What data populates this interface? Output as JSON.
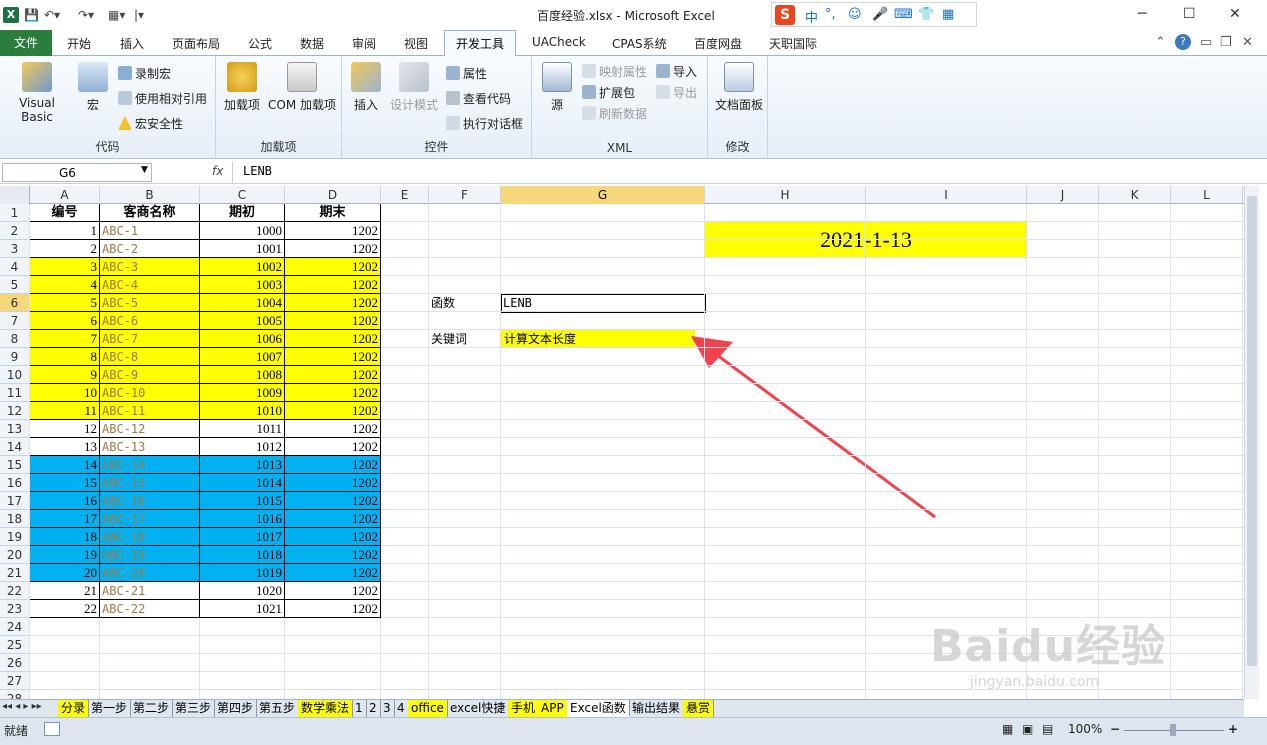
{
  "window": {
    "title": "百度经验.xlsx - Microsoft Excel",
    "logo": "X",
    "minimize": "─",
    "maximize": "☐",
    "close": "✕"
  },
  "ime": {
    "logo": "S",
    "items": [
      "中",
      "°,",
      "☺",
      "🎤",
      "⌨",
      "👕",
      "▦"
    ]
  },
  "tabs": {
    "file": "文件",
    "items": [
      "开始",
      "插入",
      "页面布局",
      "公式",
      "数据",
      "审阅",
      "视图"
    ],
    "active": "开发工具",
    "after": [
      "UACheck",
      "CPAS系统",
      "百度网盘",
      "天职国际"
    ],
    "help": "?"
  },
  "ribbon": {
    "code": {
      "label": "代码",
      "vb": "Visual Basic",
      "macro": "宏",
      "record": "录制宏",
      "relative": "使用相对引用",
      "security": "宏安全性"
    },
    "addins": {
      "label": "加载项",
      "addin": "加载项",
      "com": "COM 加载项"
    },
    "controls": {
      "label": "控件",
      "insert": "插入",
      "design": "设计模式",
      "props": "属性",
      "viewcode": "查看代码",
      "dialog": "执行对话框"
    },
    "xml": {
      "label": "XML",
      "source": "源",
      "mapprops": "映射属性",
      "expand": "扩展包",
      "refresh": "刷新数据",
      "import": "导入",
      "export": "导出"
    },
    "modify": {
      "label": "修改",
      "docpanel": "文档面板"
    }
  },
  "formula_bar": {
    "name": "G6",
    "fx": "fx",
    "value": "LENB"
  },
  "columns": [
    "A",
    "B",
    "C",
    "D",
    "E",
    "F",
    "G",
    "H",
    "I",
    "J",
    "K",
    "L"
  ],
  "selected_column": "G",
  "rows": [
    "1",
    "2",
    "3",
    "4",
    "5",
    "6",
    "7",
    "8",
    "9",
    "10",
    "11",
    "12",
    "13",
    "14",
    "15",
    "16",
    "17",
    "18",
    "19",
    "20",
    "21",
    "22",
    "23",
    "24",
    "25",
    "26",
    "27",
    "28"
  ],
  "selected_row": "6",
  "table": {
    "headers": [
      "编号",
      "客商名称",
      "期初",
      "期末"
    ],
    "rows": [
      {
        "no": "1",
        "name": "ABC-1",
        "start": "1000",
        "end": "1202",
        "fill": "none"
      },
      {
        "no": "2",
        "name": "ABC-2",
        "start": "1001",
        "end": "1202",
        "fill": "none"
      },
      {
        "no": "3",
        "name": "ABC-3",
        "start": "1002",
        "end": "1202",
        "fill": "yellow"
      },
      {
        "no": "4",
        "name": "ABC-4",
        "start": "1003",
        "end": "1202",
        "fill": "yellow"
      },
      {
        "no": "5",
        "name": "ABC-5",
        "start": "1004",
        "end": "1202",
        "fill": "yellow"
      },
      {
        "no": "6",
        "name": "ABC-6",
        "start": "1005",
        "end": "1202",
        "fill": "yellow"
      },
      {
        "no": "7",
        "name": "ABC-7",
        "start": "1006",
        "end": "1202",
        "fill": "yellow"
      },
      {
        "no": "8",
        "name": "ABC-8",
        "start": "1007",
        "end": "1202",
        "fill": "yellow"
      },
      {
        "no": "9",
        "name": "ABC-9",
        "start": "1008",
        "end": "1202",
        "fill": "yellow"
      },
      {
        "no": "10",
        "name": "ABC-10",
        "start": "1009",
        "end": "1202",
        "fill": "yellow"
      },
      {
        "no": "11",
        "name": "ABC-11",
        "start": "1010",
        "end": "1202",
        "fill": "yellow"
      },
      {
        "no": "12",
        "name": "ABC-12",
        "start": "1011",
        "end": "1202",
        "fill": "none"
      },
      {
        "no": "13",
        "name": "ABC-13",
        "start": "1012",
        "end": "1202",
        "fill": "none"
      },
      {
        "no": "14",
        "name": "ABC-14",
        "start": "1013",
        "end": "1202",
        "fill": "blue"
      },
      {
        "no": "15",
        "name": "ABC-15",
        "start": "1014",
        "end": "1202",
        "fill": "blue"
      },
      {
        "no": "16",
        "name": "ABC-16",
        "start": "1015",
        "end": "1202",
        "fill": "blue"
      },
      {
        "no": "17",
        "name": "ABC-17",
        "start": "1016",
        "end": "1202",
        "fill": "blue"
      },
      {
        "no": "18",
        "name": "ABC-18",
        "start": "1017",
        "end": "1202",
        "fill": "blue"
      },
      {
        "no": "19",
        "name": "ABC-19",
        "start": "1018",
        "end": "1202",
        "fill": "blue"
      },
      {
        "no": "20",
        "name": "ABC-20",
        "start": "1019",
        "end": "1202",
        "fill": "blue"
      },
      {
        "no": "21",
        "name": "ABC-21",
        "start": "1020",
        "end": "1202",
        "fill": "none"
      },
      {
        "no": "22",
        "name": "ABC-22",
        "start": "1021",
        "end": "1202",
        "fill": "none"
      }
    ]
  },
  "cells": {
    "date": "2021-1-13",
    "func_label": "函数",
    "func_value": "LENB",
    "keyword_label": "关键词",
    "keyword_value": "计算文本长度"
  },
  "colors": {
    "yellow": "#ffff00",
    "blue": "#00b0f0",
    "arrow": "#f0434f"
  },
  "sheet_tabs": [
    {
      "name": "分录",
      "fill": "yellow"
    },
    {
      "name": "第一步",
      "fill": "none"
    },
    {
      "name": "第二步",
      "fill": "none"
    },
    {
      "name": "第三步",
      "fill": "none"
    },
    {
      "name": "第四步",
      "fill": "none"
    },
    {
      "name": "第五步",
      "fill": "none"
    },
    {
      "name": "数学乘法",
      "fill": "yellow"
    },
    {
      "name": "1",
      "fill": "none"
    },
    {
      "name": "2",
      "fill": "none"
    },
    {
      "name": "3",
      "fill": "none"
    },
    {
      "name": "4",
      "fill": "none"
    },
    {
      "name": "office",
      "fill": "yellow"
    },
    {
      "name": "excel快捷",
      "fill": "none"
    },
    {
      "name": "手机",
      "fill": "yellow"
    },
    {
      "name": "APP",
      "fill": "yellow"
    },
    {
      "name": "Excel函数",
      "fill": "active"
    },
    {
      "name": "输出结果",
      "fill": "none"
    },
    {
      "name": "悬赏",
      "fill": "yellow"
    }
  ],
  "status": {
    "ready": "就绪",
    "zoom": "100%",
    "zoom_out": "−",
    "zoom_in": "+"
  },
  "watermark": {
    "brand": "Baidu经验",
    "url": "jingyan.baidu.com"
  }
}
